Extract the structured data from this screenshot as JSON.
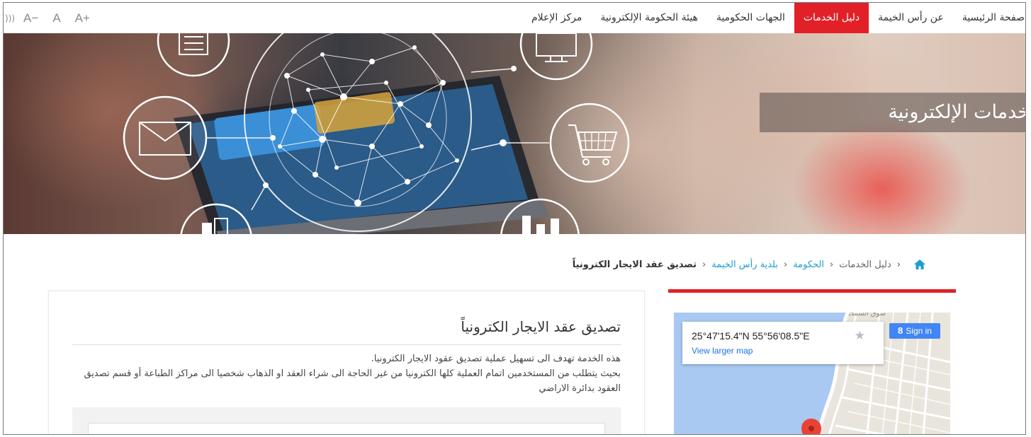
{
  "accessibility": {
    "sound_icon": "speaker-icon",
    "font_decrease": "A−",
    "font_reset": "A",
    "font_increase": "A+"
  },
  "nav": {
    "items": [
      {
        "label": "صفحة الرئيسية",
        "active": false
      },
      {
        "label": "عن رأس الخيمة",
        "active": false
      },
      {
        "label": "دليل الخدمات",
        "active": true
      },
      {
        "label": "الجهات الحكومية",
        "active": false
      },
      {
        "label": "هيئة الحكومة الإلكترونية",
        "active": false
      },
      {
        "label": "مركز الإعلام",
        "active": false
      }
    ]
  },
  "hero": {
    "title": "خدمات الإلكترونية"
  },
  "breadcrumb": {
    "home_icon": "home-icon",
    "items": [
      {
        "label": "دليل الخدمات",
        "type": "plain"
      },
      {
        "label": "الحكومة",
        "type": "link"
      },
      {
        "label": "بلدية رأس الخيمة",
        "type": "link"
      },
      {
        "label": "تصديق عقد الايجار الكترونياً",
        "type": "current"
      }
    ]
  },
  "service": {
    "title": "تصديق عقد الايجار الكترونياً",
    "description_line1": "هذه الخدمة تهدف الى تسهيل عملية تصديق عقود الايجار الكترونيا.",
    "description_line2": "بحيث يتطلب من المستخدمين اتمام العملية كلها الكترونيا من غير الحاجة الى شراء العقد او الذهاب شخصيا الى مراكز الطباعة أو قسم تصديق العقود بدائرة الاراضي"
  },
  "map": {
    "coordinates": "25°47'15.4\"N 55°56'08.5\"E",
    "view_larger": "View larger map",
    "sign_in": "Sign in",
    "colors": {
      "water": "#a9c9f2",
      "land": "#e9e5dc",
      "pin": "#ea4335",
      "button": "#4285f4"
    }
  },
  "colors": {
    "accent": "#e22028",
    "link": "#1a9fd4"
  }
}
